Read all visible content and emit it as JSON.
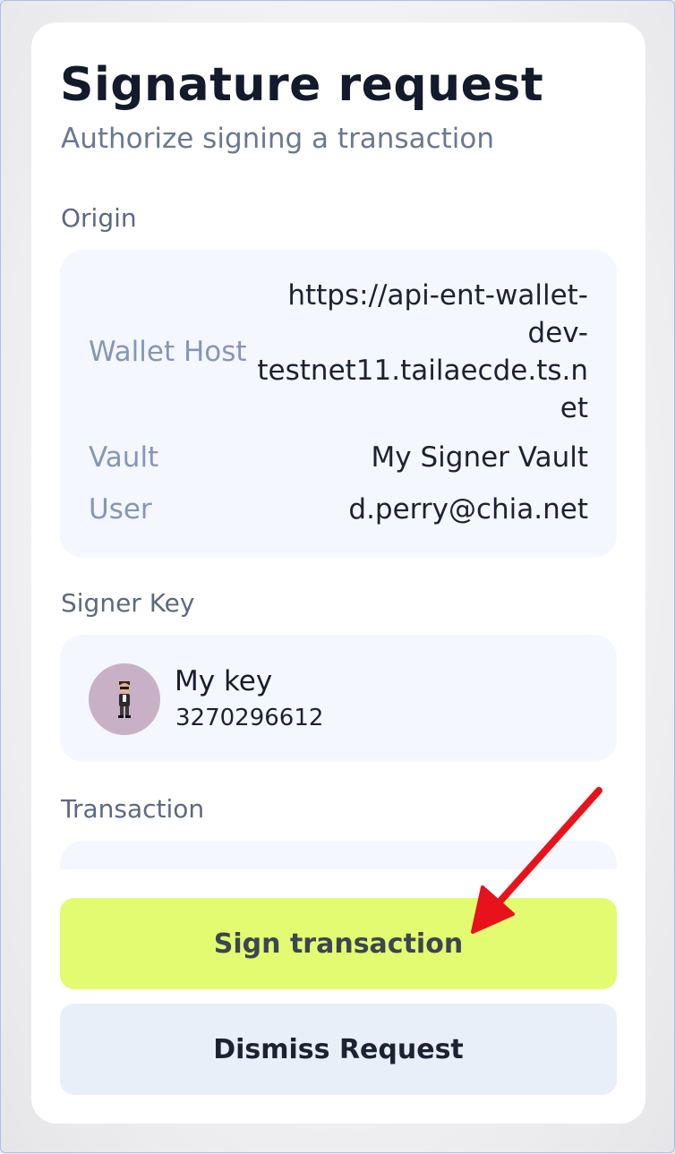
{
  "page": {
    "title": "Signature request",
    "subtitle": "Authorize signing a transaction"
  },
  "origin": {
    "section_label": "Origin",
    "wallet_host_label": "Wallet Host",
    "wallet_host_lines": [
      "https://api-ent-wallet-",
      "dev-",
      "testnet11.tailaecde.ts.n",
      "et"
    ],
    "vault_label": "Vault",
    "vault_value": "My Signer Vault",
    "user_label": "User",
    "user_value": "d.perry@chia.net"
  },
  "signer_key": {
    "section_label": "Signer Key",
    "avatar_icon": "person-figure-icon",
    "name": "My key",
    "fingerprint": "3270296612"
  },
  "transaction": {
    "section_label": "Transaction"
  },
  "actions": {
    "sign_label": "Sign transaction",
    "dismiss_label": "Dismiss Request"
  },
  "colors": {
    "primary_button": "#e3fb70",
    "secondary_button": "#e9eff9",
    "panel_background": "#f4f7fd",
    "annotation_arrow": "#e8121b"
  }
}
